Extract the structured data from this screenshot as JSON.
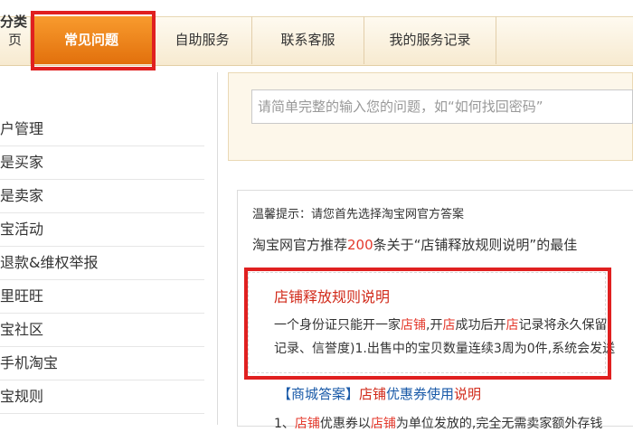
{
  "tabs": [
    {
      "label": "页"
    },
    {
      "label": "常见问题"
    },
    {
      "label": "自助服务"
    },
    {
      "label": "联系客服"
    },
    {
      "label": "我的服务记录"
    }
  ],
  "sidebar": {
    "title": "分类",
    "items": [
      {
        "label": "户管理"
      },
      {
        "label": "是买家"
      },
      {
        "label": "是卖家"
      },
      {
        "label": "宝活动"
      },
      {
        "label": "退款&维权举报"
      },
      {
        "label": "里旺旺"
      },
      {
        "label": "宝社区"
      },
      {
        "label": "手机淘宝"
      },
      {
        "label": "宝规则"
      }
    ]
  },
  "search": {
    "placeholder": "请简单完整的输入您的问题，如“如何找回密码”"
  },
  "results": {
    "tip": "温馨提示：请您首先选择淘宝网官方答案",
    "count_prefix": "淘宝网官方推荐",
    "count_value": "200",
    "count_suffix": "条关于“店铺释放规则说明”的最佳",
    "first": {
      "title": "店铺释放规则说明",
      "line1_a": "一个身份证只能开一家",
      "line1_b": "店铺",
      "line1_c": ",开",
      "line1_d": "店",
      "line1_e": "成功后开",
      "line1_f": "店",
      "line1_g": "记录将永久保留,",
      "line2": "记录、信誉度)1.出售中的宝贝数量连续3周为0件,系统会发送"
    },
    "second": {
      "tag": "【商城答案】",
      "t1": "店铺",
      "t2": "优惠券使用",
      "t3": "说明"
    },
    "third": {
      "a": "1、",
      "b": "店铺",
      "c": "优惠券以",
      "d": "店铺",
      "e": "为单位发放的,完全无需卖家额外存钱"
    }
  },
  "colors": {
    "active_tab": "#f08a1f",
    "annotation": "#e02020",
    "highlight": "#e4392c",
    "link_blue": "#1a5aa8"
  }
}
